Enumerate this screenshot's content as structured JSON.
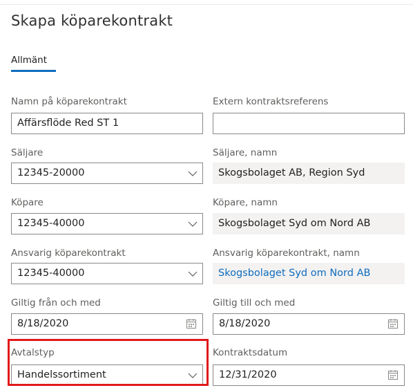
{
  "page": {
    "title": "Skapa köparekontrakt"
  },
  "tabs": [
    {
      "label": "Allmänt"
    }
  ],
  "form": {
    "contract_name": {
      "label": "Namn på köparekontrakt",
      "value": "Affärsflöde Red ST 1"
    },
    "external_ref": {
      "label": "Extern kontraktsreferens",
      "value": ""
    },
    "seller": {
      "label": "Säljare",
      "value": "12345-20000"
    },
    "seller_name": {
      "label": "Säljare, namn",
      "value": "Skogsbolaget AB, Region Syd"
    },
    "buyer": {
      "label": "Köpare",
      "value": "12345-40000"
    },
    "buyer_name": {
      "label": "Köpare, namn",
      "value": "Skogsbolaget Syd om Nord AB"
    },
    "responsible": {
      "label": "Ansvarig köparekontrakt",
      "value": "12345-40000"
    },
    "responsible_name": {
      "label": "Ansvarig köparekontrakt, namn",
      "value": "Skogsbolaget Syd om Nord AB"
    },
    "valid_from": {
      "label": "Giltig från och med",
      "value": "8/18/2020"
    },
    "valid_to": {
      "label": "Giltig till och med",
      "value": "8/18/2020"
    },
    "agreement_type": {
      "label": "Avtalstyp",
      "value": "Handelssortiment"
    },
    "contract_date": {
      "label": "Kontraktsdatum",
      "value": "12/31/2020"
    }
  },
  "icons": {
    "dropdown": "chevron-down-icon",
    "date": "calendar-icon"
  },
  "colors": {
    "accent": "#0f6cbd",
    "highlight": "#e11919",
    "link": "#0f6cbd"
  }
}
